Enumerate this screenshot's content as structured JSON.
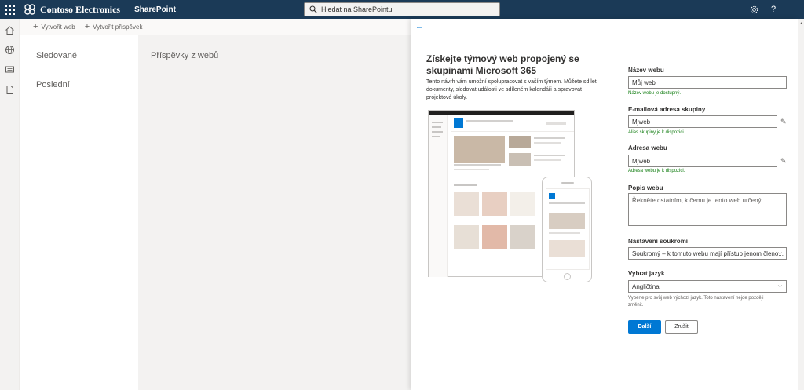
{
  "suitebar": {
    "brand_name": "Contoso Electronics",
    "app_name": "SharePoint",
    "search_placeholder": "Hledat na SharePointu",
    "bg_color": "#1b3a57"
  },
  "command_bar": {
    "create_site": "Vytvořit web",
    "create_post": "Vytvořit příspěvek"
  },
  "left_nav": {
    "items": [
      "Sledované",
      "Poslední"
    ]
  },
  "main": {
    "title": "Příspěvky z webů"
  },
  "panel": {
    "title": "Získejte týmový web propojený se skupinami Microsoft 365",
    "description": "Tento návrh vám umožní spolupracovat s vaším týmem. Můžete sdílet dokumenty, sledovat události ve sdíleném kalendáři a spravovat projektové úkoly.",
    "form": {
      "site_name": {
        "label": "Název webu",
        "value": "Můj web",
        "validation": "Název webu je dostupný."
      },
      "group_email": {
        "label": "E-mailová adresa skupiny",
        "value": "Mjweb",
        "validation": "Alias skupiny je k dispozici."
      },
      "site_address": {
        "label": "Adresa webu",
        "value": "Mjweb",
        "validation": "Adresa webu je k dispozici."
      },
      "site_description": {
        "label": "Popis webu",
        "placeholder": "Řekněte ostatním, k čemu je tento web určený."
      },
      "privacy": {
        "label": "Nastavení soukromí",
        "value": "Soukromý – k tomuto webu mají přístup jenom členo..."
      },
      "language": {
        "label": "Vybrat jazyk",
        "value": "Angličtina",
        "help": "Vyberte pro svůj web výchozí jazyk. Toto nastavení nejde později změnit."
      },
      "next_button": "Další",
      "cancel_button": "Zrušit"
    }
  },
  "colors": {
    "accent": "#0078d4",
    "success": "#107c10"
  }
}
